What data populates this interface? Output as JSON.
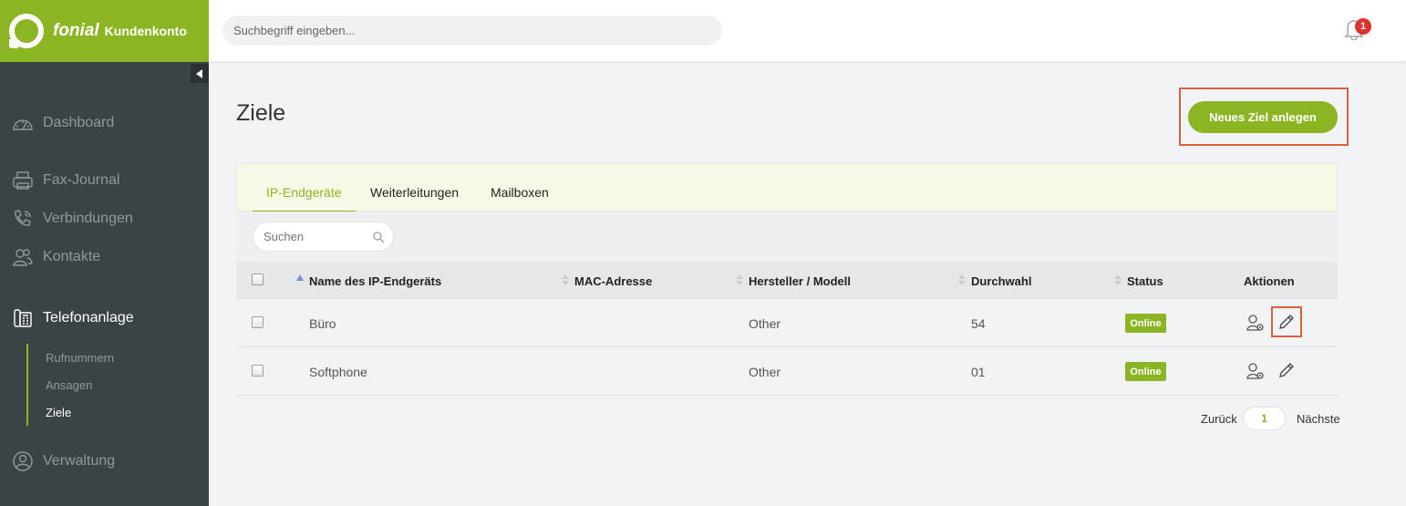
{
  "brand": {
    "name": "fonial",
    "subtitle": "Kundenkonto"
  },
  "topbar": {
    "search_placeholder": "Suchbegriff eingeben...",
    "notification_count": "1"
  },
  "sidebar": {
    "items": [
      {
        "label": "Dashboard",
        "icon": "dashboard-icon"
      },
      {
        "label": "Fax-Journal",
        "icon": "fax-icon"
      },
      {
        "label": "Verbindungen",
        "icon": "phone-icon"
      },
      {
        "label": "Kontakte",
        "icon": "contacts-icon"
      },
      {
        "label": "Telefonanlage",
        "icon": "pbx-icon"
      },
      {
        "label": "Verwaltung",
        "icon": "admin-icon"
      }
    ],
    "subitems": [
      {
        "label": "Rufnummern"
      },
      {
        "label": "Ansagen"
      },
      {
        "label": "Ziele"
      }
    ]
  },
  "main": {
    "title": "Ziele",
    "new_button": "Neues Ziel anlegen",
    "tabs": [
      {
        "label": "IP-Endgeräte"
      },
      {
        "label": "Weiterleitungen"
      },
      {
        "label": "Mailboxen"
      }
    ],
    "filter_placeholder": "Suchen",
    "columns": {
      "name": "Name des IP-Endgeräts",
      "mac": "MAC-Adresse",
      "vendor": "Hersteller / Modell",
      "extension": "Durchwahl",
      "status": "Status",
      "actions": "Aktionen"
    },
    "rows": [
      {
        "name": "Büro",
        "mac": "",
        "vendor": "Other",
        "extension": "54",
        "status": "Online"
      },
      {
        "name": "Softphone",
        "mac": "",
        "vendor": "Other",
        "extension": "01",
        "status": "Online"
      }
    ],
    "pagination": {
      "prev": "Zurück",
      "page": "1",
      "next": "Nächste"
    }
  },
  "colors": {
    "accent": "#8cb524",
    "sidebar": "#3a4447",
    "highlight": "#d9613b",
    "badge": "#e03131"
  }
}
